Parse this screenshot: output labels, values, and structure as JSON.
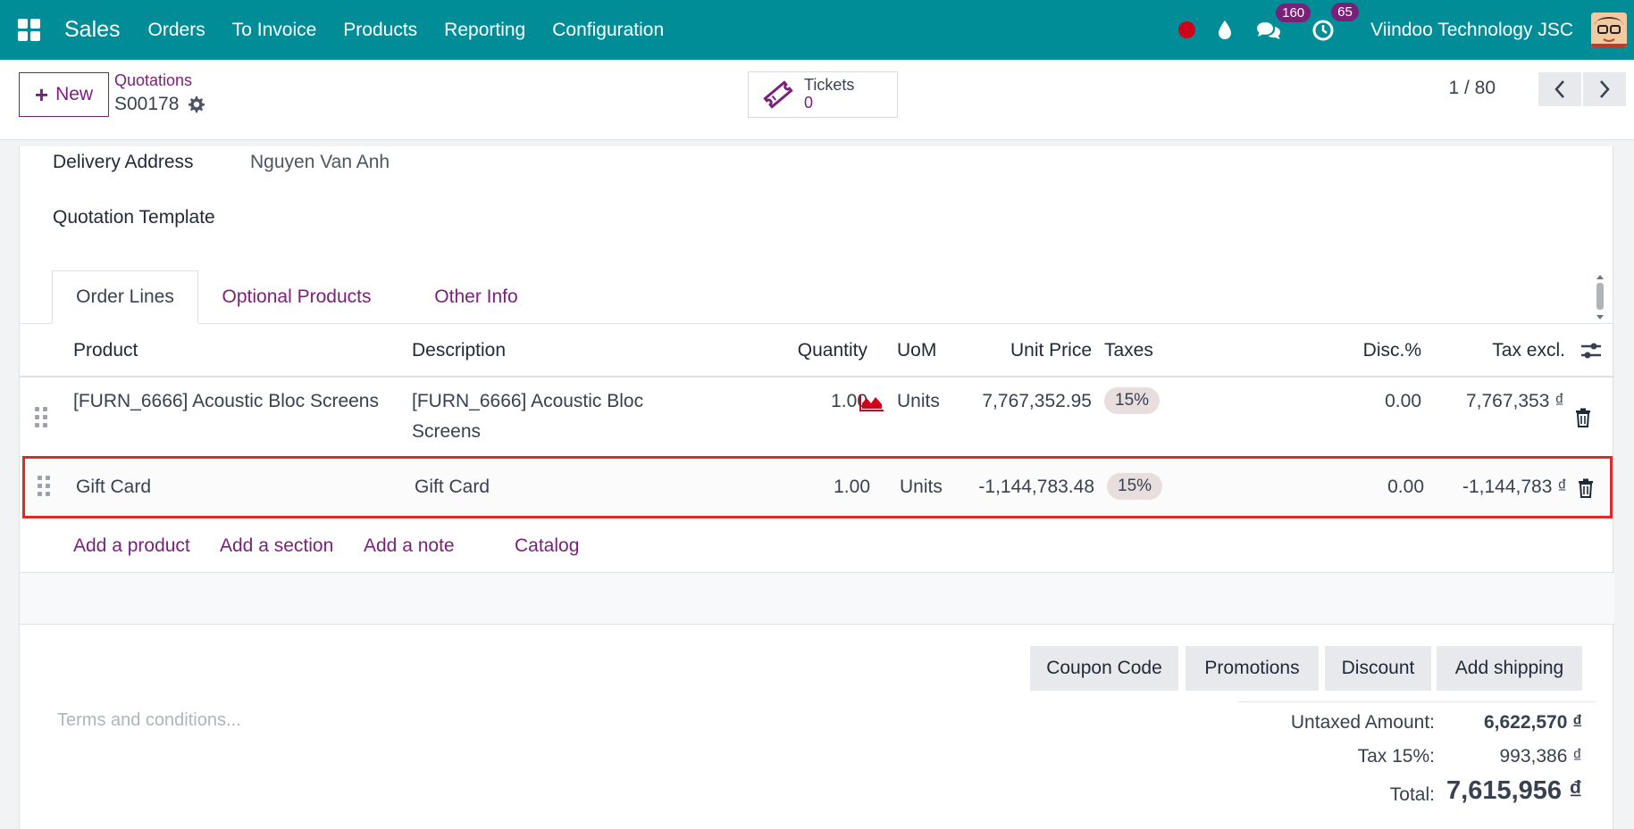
{
  "navbar": {
    "app_name": "Sales",
    "menu": [
      "Orders",
      "To Invoice",
      "Products",
      "Reporting",
      "Configuration"
    ],
    "messages_badge": "160",
    "activities_badge": "65",
    "company": "Viindoo Technology JSC",
    "accent": "#018d98"
  },
  "control": {
    "new_label": "New",
    "breadcrumb_parent": "Quotations",
    "breadcrumb_current": "S00178",
    "tickets_label": "Tickets",
    "tickets_count": "0",
    "pager": "1 / 80"
  },
  "form": {
    "delivery_label": "Delivery Address",
    "delivery_value": "Nguyen Van Anh",
    "template_label": "Quotation Template"
  },
  "tabs": [
    "Order Lines",
    "Optional Products",
    "Other Info"
  ],
  "table": {
    "headers": {
      "product": "Product",
      "description": "Description",
      "quantity": "Quantity",
      "uom": "UoM",
      "unit_price": "Unit Price",
      "taxes": "Taxes",
      "disc": "Disc.%",
      "tax_excl": "Tax excl."
    },
    "rows": [
      {
        "product": "[FURN_6666] Acoustic Bloc Screens",
        "description_l1": "[FURN_6666] Acoustic Bloc",
        "description_l2": "Screens",
        "quantity": "1.00",
        "uom": "Units",
        "unit_price": "7,767,352.95",
        "tax": "15%",
        "disc": "0.00",
        "subtotal": "7,767,353 ₫"
      },
      {
        "product": "Gift Card",
        "description": "Gift Card",
        "quantity": "1.00",
        "uom": "Units",
        "unit_price": "-1,144,783.48",
        "tax": "15%",
        "disc": "0.00",
        "subtotal": "-1,144,783 ₫"
      }
    ]
  },
  "add_links": [
    "Add a product",
    "Add a section",
    "Add a note",
    "Catalog"
  ],
  "promo_buttons": [
    "Coupon Code",
    "Promotions",
    "Discount",
    "Add shipping"
  ],
  "terms_placeholder": "Terms and conditions...",
  "totals": {
    "untaxed_label": "Untaxed Amount:",
    "untaxed_value": "6,622,570 ₫",
    "tax_label": "Tax 15%:",
    "tax_value": "993,386 ₫",
    "total_label": "Total:",
    "total_value": "7,615,956 ₫"
  }
}
